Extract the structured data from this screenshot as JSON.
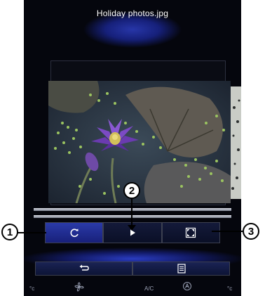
{
  "header": {
    "filename": "Holiday photos.jpg"
  },
  "viewer": {
    "image": "water-lily-photo",
    "next_image": "partial-next-photo"
  },
  "controls": {
    "repeat": {
      "icon": "repeat-icon"
    },
    "play": {
      "icon": "play-icon"
    },
    "fullscreen": {
      "icon": "fullscreen-icon"
    }
  },
  "nav": {
    "back": {
      "icon": "back-arrow-icon"
    },
    "menu": {
      "icon": "list-menu-icon"
    }
  },
  "climate": {
    "left_temp_unit": "°c",
    "fan_icon": "fan-icon",
    "ac_label": "A/C",
    "auto_icon": "auto-climate-icon",
    "right_temp_unit": "°c"
  },
  "callouts": [
    "1",
    "2",
    "3"
  ],
  "colors": {
    "screen_bg": "#05060d",
    "accent_blue": "#2a3aa8",
    "callout_border": "#000000"
  }
}
